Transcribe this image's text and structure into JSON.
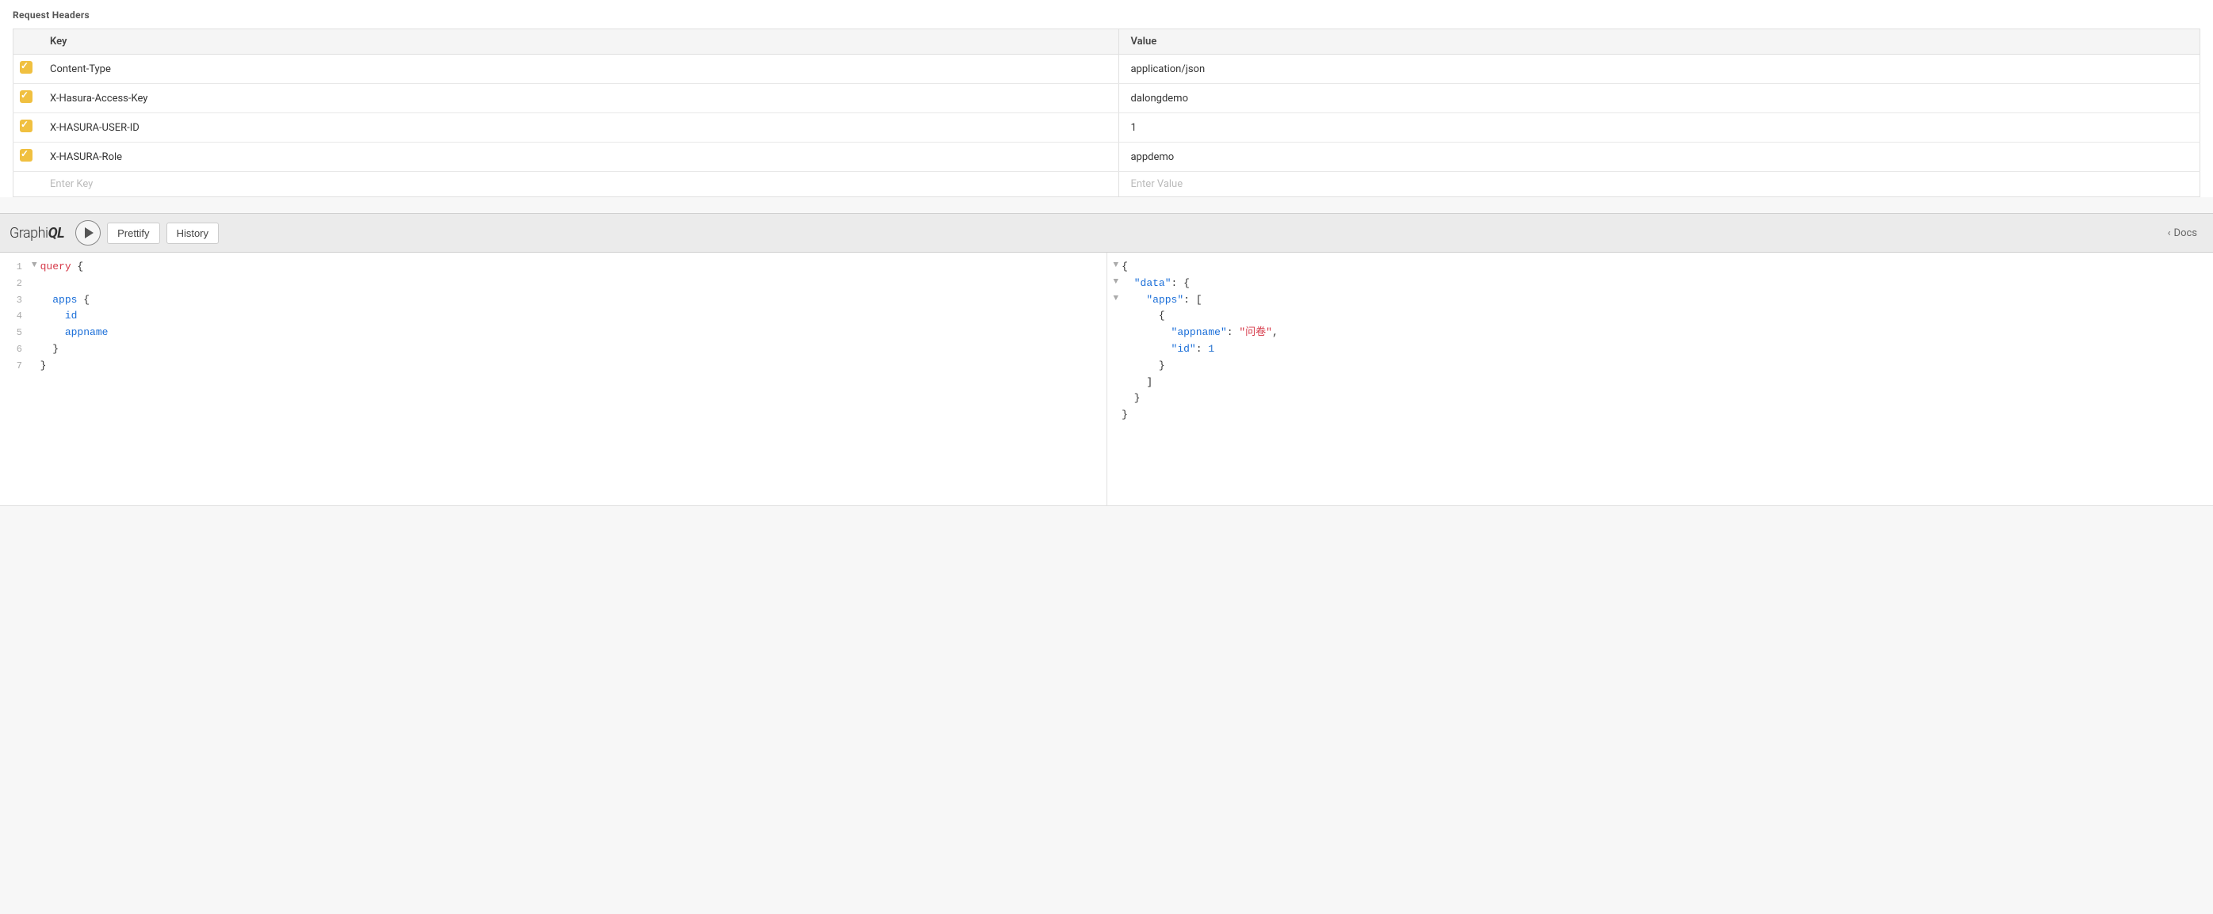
{
  "requestHeaders": {
    "title": "Request Headers",
    "columns": {
      "key": "Key",
      "value": "Value"
    },
    "rows": [
      {
        "id": 1,
        "checked": true,
        "key": "Content-Type",
        "value": "application/json"
      },
      {
        "id": 2,
        "checked": true,
        "key": "X-Hasura-Access-Key",
        "value": "dalongdemo"
      },
      {
        "id": 3,
        "checked": true,
        "key": "X-HASURA-USER-ID",
        "value": "1"
      },
      {
        "id": 4,
        "checked": true,
        "key": "X-HASURA-Role",
        "value": "appdemo"
      }
    ],
    "emptyRow": {
      "keyPlaceholder": "Enter Key",
      "valuePlaceholder": "Enter Value"
    }
  },
  "graphiql": {
    "title_graphi": "Graphi",
    "title_ql": "QL",
    "runButton": "▶",
    "prettifyLabel": "Prettify",
    "historyLabel": "History",
    "docsLabel": "< Docs"
  },
  "queryEditor": {
    "lines": [
      {
        "num": "1",
        "arrow": "▼",
        "content_kw": "query",
        "content_plain": " {"
      },
      {
        "num": "2",
        "arrow": "",
        "content_plain": ""
      },
      {
        "num": "3",
        "arrow": "",
        "content_kw_field": "  apps",
        "content_plain": " {"
      },
      {
        "num": "4",
        "arrow": "",
        "content_plain": "    ",
        "content_kw_field2": "id"
      },
      {
        "num": "5",
        "arrow": "",
        "content_plain": "    ",
        "content_kw_field2": "appname"
      },
      {
        "num": "6",
        "arrow": "",
        "content_plain": "  }"
      },
      {
        "num": "7",
        "arrow": "",
        "content_plain": "}"
      }
    ]
  },
  "resultPanel": {
    "lines": [
      {
        "num": "",
        "arrow": "▼",
        "content": "{"
      },
      {
        "num": "",
        "arrow": "▼",
        "indent": "  ",
        "key": "\"data\"",
        "colon": ": {"
      },
      {
        "num": "",
        "arrow": "▼",
        "indent": "    ",
        "key": "\"apps\"",
        "colon": ": ["
      },
      {
        "num": "",
        "arrow": "",
        "indent": "      ",
        "plain": "{"
      },
      {
        "num": "",
        "arrow": "",
        "indent": "        ",
        "key": "\"appname\"",
        "colon": ": ",
        "strval": "\"问卷\"",
        "trail": ","
      },
      {
        "num": "",
        "arrow": "",
        "indent": "        ",
        "key": "\"id\"",
        "colon": ": ",
        "numval": "1"
      },
      {
        "num": "",
        "arrow": "",
        "indent": "      ",
        "plain": "}"
      },
      {
        "num": "",
        "arrow": "",
        "indent": "    ",
        "plain": "]"
      },
      {
        "num": "",
        "arrow": "",
        "indent": "  ",
        "plain": "}"
      },
      {
        "num": "",
        "arrow": "",
        "indent": "",
        "plain": "}"
      }
    ]
  }
}
